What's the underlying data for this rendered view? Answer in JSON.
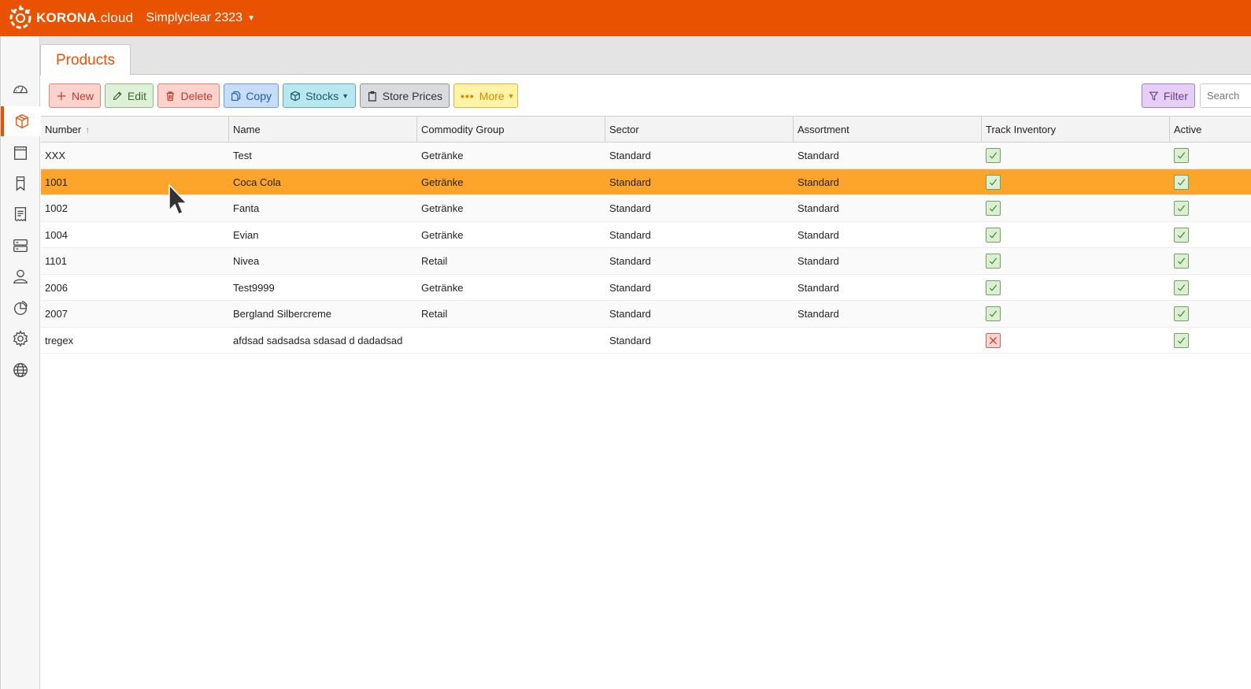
{
  "app": {
    "logo_name": "KORONA",
    "logo_suffix": ".cloud",
    "tenant": "Simplyclear 2323"
  },
  "colors": {
    "brand": "#e85200",
    "selected_row": "#fda42a"
  },
  "sidebar": {
    "items": [
      {
        "icon": "dashboard-icon"
      },
      {
        "icon": "products-box-icon",
        "active": true
      },
      {
        "icon": "calendar-icon"
      },
      {
        "icon": "bookmark-icon"
      },
      {
        "icon": "receipt-icon"
      },
      {
        "icon": "server-icon"
      },
      {
        "icon": "user-icon"
      },
      {
        "icon": "pie-chart-icon"
      },
      {
        "icon": "gear-icon"
      },
      {
        "icon": "globe-icon"
      }
    ]
  },
  "tab": {
    "label": "Products"
  },
  "toolbar": {
    "new_label": "New",
    "edit_label": "Edit",
    "delete_label": "Delete",
    "copy_label": "Copy",
    "stocks_label": "Stocks",
    "store_prices_label": "Store Prices",
    "more_label": "More",
    "filter_label": "Filter",
    "search_placeholder": "Search"
  },
  "table": {
    "columns": [
      "Number",
      "Name",
      "Commodity Group",
      "Sector",
      "Assortment",
      "Track Inventory",
      "Active"
    ],
    "sorted_column": "Number",
    "selected_row": 1,
    "rows": [
      {
        "number": "XXX",
        "name": "Test",
        "commodity_group": "Getränke",
        "sector": "Standard",
        "assortment": "Standard",
        "track_inventory": true,
        "active": true
      },
      {
        "number": "1001",
        "name": "Coca Cola",
        "commodity_group": "Getränke",
        "sector": "Standard",
        "assortment": "Standard",
        "track_inventory": true,
        "active": true
      },
      {
        "number": "1002",
        "name": "Fanta",
        "commodity_group": "Getränke",
        "sector": "Standard",
        "assortment": "Standard",
        "track_inventory": true,
        "active": true
      },
      {
        "number": "1004",
        "name": "Evian",
        "commodity_group": "Getränke",
        "sector": "Standard",
        "assortment": "Standard",
        "track_inventory": true,
        "active": true
      },
      {
        "number": "1101",
        "name": "Nivea",
        "commodity_group": "Retail",
        "sector": "Standard",
        "assortment": "Standard",
        "track_inventory": true,
        "active": true
      },
      {
        "number": "2006",
        "name": "Test9999",
        "commodity_group": "Getränke",
        "sector": "Standard",
        "assortment": "Standard",
        "track_inventory": true,
        "active": true
      },
      {
        "number": "2007",
        "name": "Bergland Silbercreme",
        "commodity_group": "Retail",
        "sector": "Standard",
        "assortment": "Standard",
        "track_inventory": true,
        "active": true
      },
      {
        "number": "tregex",
        "name": "afdsad sadsadsa sdasad d dadadsad",
        "commodity_group": "",
        "sector": "Standard",
        "assortment": "",
        "track_inventory": false,
        "active": true
      }
    ]
  }
}
